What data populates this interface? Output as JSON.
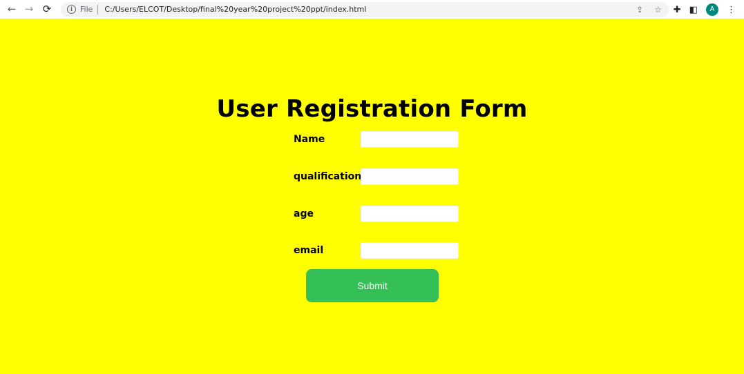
{
  "browser": {
    "back_icon": "←",
    "forward_icon": "→",
    "reload_icon": "⟳",
    "info_icon": "i",
    "scheme_label": "File",
    "url": "C:/Users/ELCOT/Desktop/final%20year%20project%20ppt/index.html",
    "share_icon": "⇪",
    "bookmark_icon": "☆",
    "extensions_icon": "✚",
    "sidepanel_icon": "◧",
    "avatar_letter": "A",
    "menu_icon": "⋮"
  },
  "page": {
    "background_color": "#ffff00",
    "title": "User Registration Form"
  },
  "form": {
    "fields": [
      {
        "label": "Name",
        "value": ""
      },
      {
        "label": "qualification",
        "value": ""
      },
      {
        "label": "age",
        "value": ""
      },
      {
        "label": "email",
        "value": ""
      }
    ],
    "submit_label": "Submit",
    "submit_color": "#34bf57"
  }
}
